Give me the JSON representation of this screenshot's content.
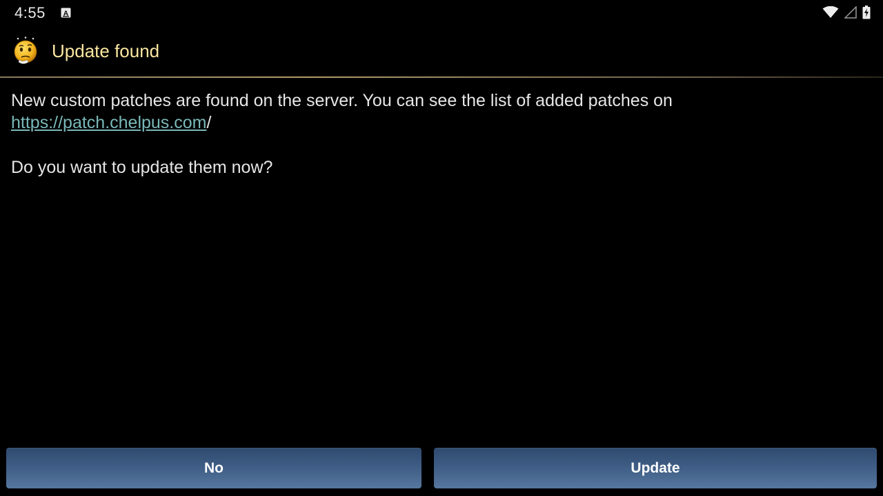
{
  "status_bar": {
    "time": "4:55",
    "notification_icon": "a-box-icon",
    "wifi_icon": "wifi-icon",
    "signal_icon": "cell-signal-icon",
    "battery_icon": "battery-charging-icon"
  },
  "dialog": {
    "title": "Update found",
    "title_icon": "thinking-smiley-icon",
    "message_text": "New custom patches are found on the server. You can see the list of added patches on",
    "link_text": "https://patch.chelpus.com",
    "link_suffix": "/",
    "question": "Do you want to update them now?",
    "buttons": {
      "no_label": "No",
      "update_label": "Update"
    }
  },
  "colors": {
    "background": "#000000",
    "title": "#fbe7a1",
    "link": "#7ab8b8",
    "button": "#3e5c84"
  }
}
